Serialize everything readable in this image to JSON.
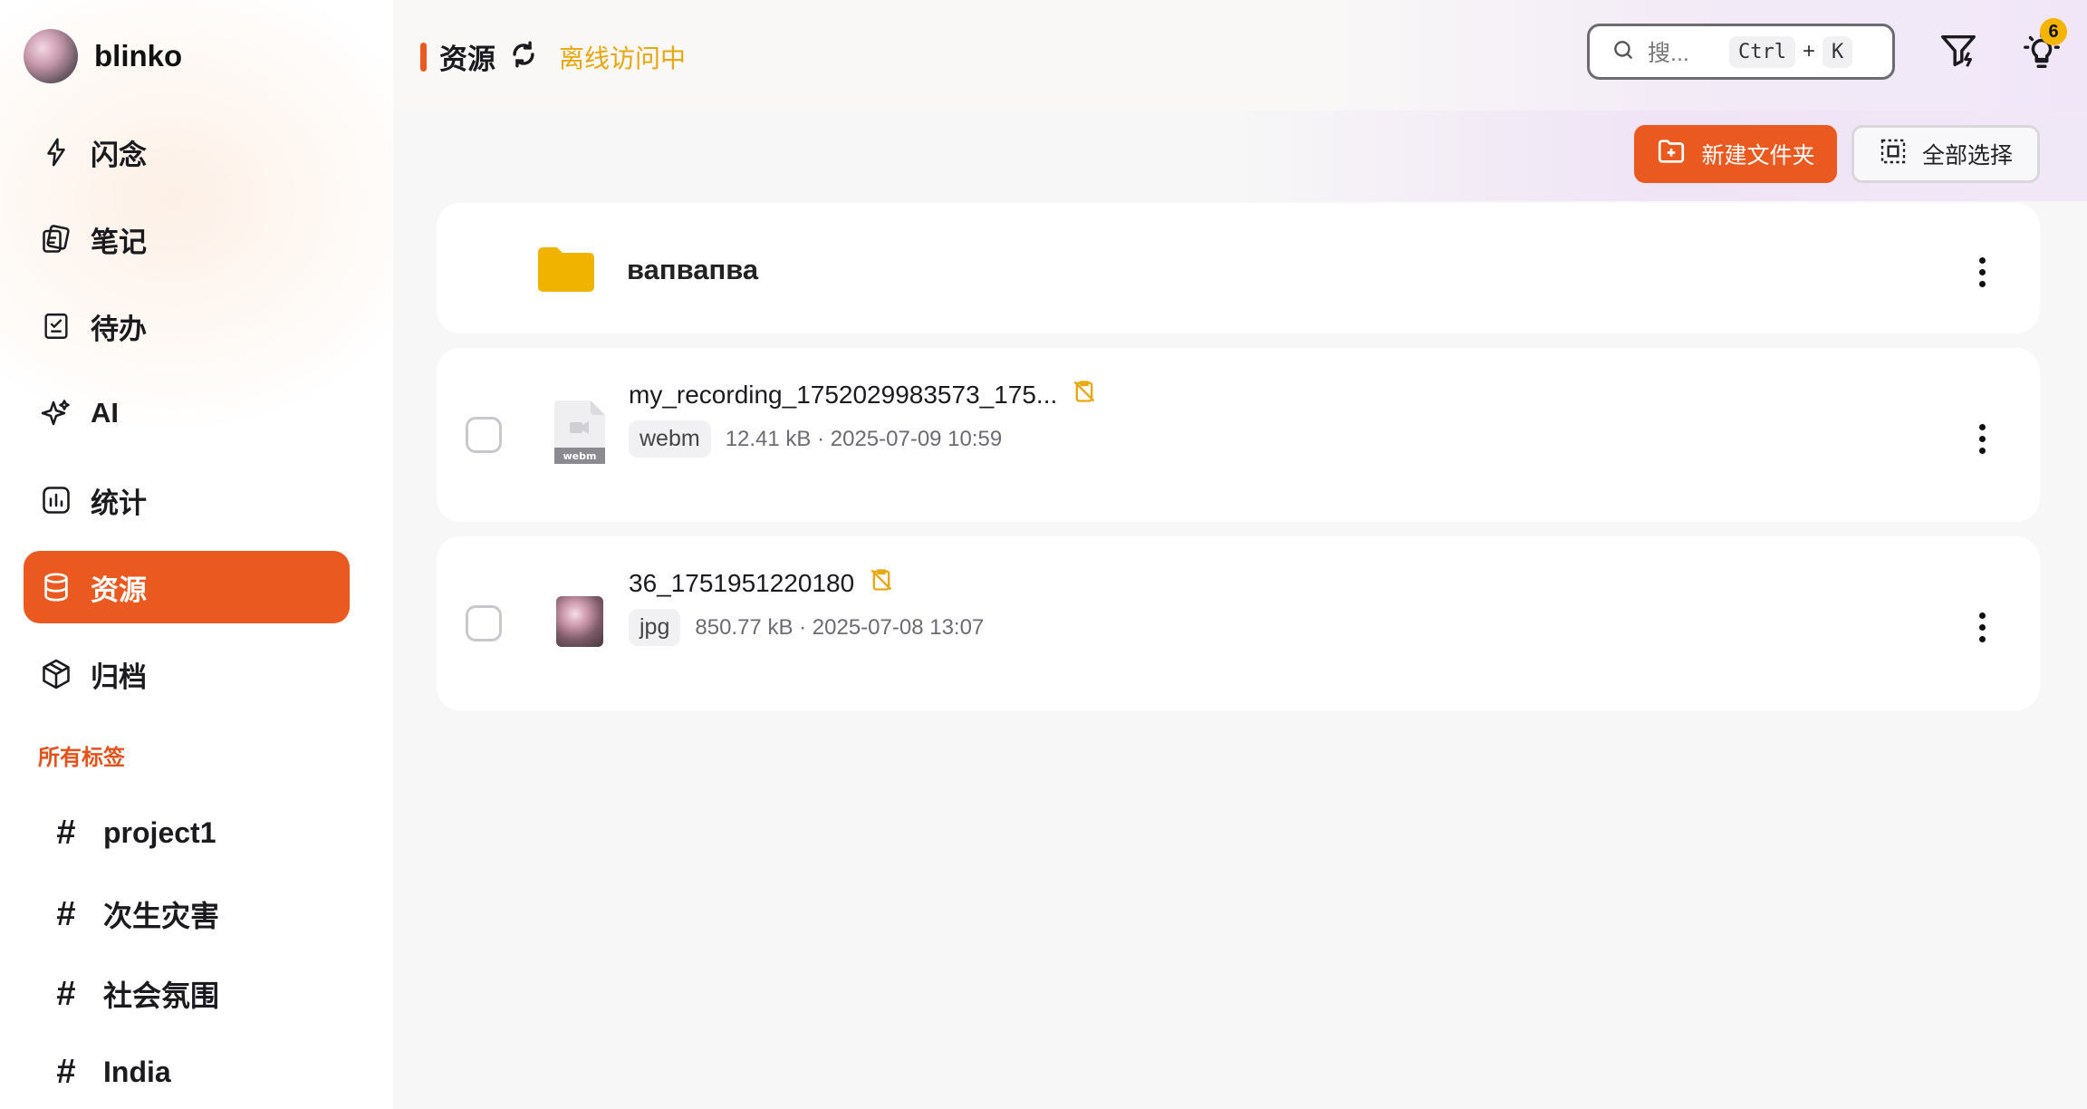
{
  "sidebar": {
    "brand_name": "blinko",
    "nav": [
      {
        "label": "闪念",
        "icon": "flash-icon"
      },
      {
        "label": "笔记",
        "icon": "notes-icon"
      },
      {
        "label": "待办",
        "icon": "todo-icon"
      },
      {
        "label": "AI",
        "icon": "sparkle-icon"
      },
      {
        "label": "统计",
        "icon": "stats-icon"
      },
      {
        "label": "资源",
        "icon": "database-icon",
        "active": true
      },
      {
        "label": "归档",
        "icon": "archive-box-icon"
      }
    ],
    "tags_heading": "所有标签",
    "tags": [
      "project1",
      "次生灾害",
      "社会氛围",
      "India"
    ]
  },
  "header": {
    "title": "资源",
    "offline_status": "离线访问中",
    "search": {
      "placeholder": "搜...",
      "key1": "Ctrl",
      "plus": "+",
      "key2": "K"
    },
    "notification_count": "6"
  },
  "toolbar": {
    "new_folder_label": "新建文件夹",
    "select_all_label": "全部选择"
  },
  "resources": {
    "folder": {
      "name": "вапвапва"
    },
    "files": [
      {
        "name": "my_recording_1752029983573_175...",
        "ext": "webm",
        "size_date": "12.41 kB · 2025-07-09 10:59"
      },
      {
        "name": "36_1751951220180",
        "ext": "jpg",
        "size_date": "850.77 kB · 2025-07-08 13:07"
      }
    ]
  },
  "colors": {
    "accent": "#ea5a20",
    "offline": "#e9a60d",
    "folder": "#f0b400",
    "tag_heading": "#e4521c"
  }
}
